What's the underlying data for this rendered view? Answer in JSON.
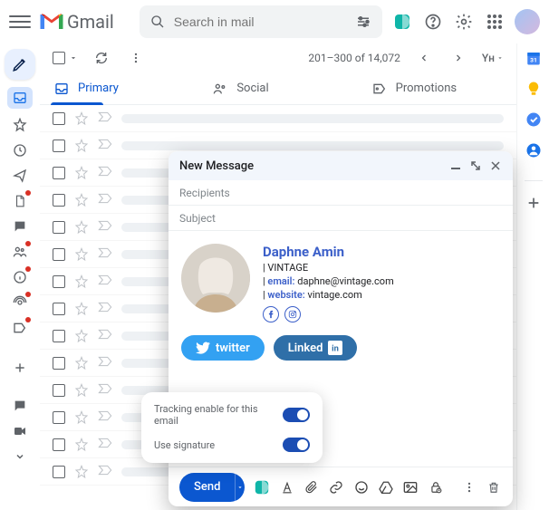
{
  "header": {
    "brand": "Gmail",
    "search_placeholder": "Search in mail"
  },
  "toolbar": {
    "pagination": "201–300 of 14,072",
    "lang": "Yн"
  },
  "tabs": {
    "primary": "Primary",
    "social": "Social",
    "promotions": "Promotions"
  },
  "compose": {
    "title": "New Message",
    "recipients": "Recipients",
    "subject": "Subject",
    "send": "Send"
  },
  "signature": {
    "name": "Daphne Amin",
    "company": "VINTAGE",
    "email_label": "email:",
    "email_value": "daphne@vintage.com",
    "website_label": "website:",
    "website_value": "vintage.com",
    "twitter": "twitter",
    "linkedin": "Linked"
  },
  "popup": {
    "tracking": "Tracking enable for this email",
    "use_signature": "Use signature"
  }
}
